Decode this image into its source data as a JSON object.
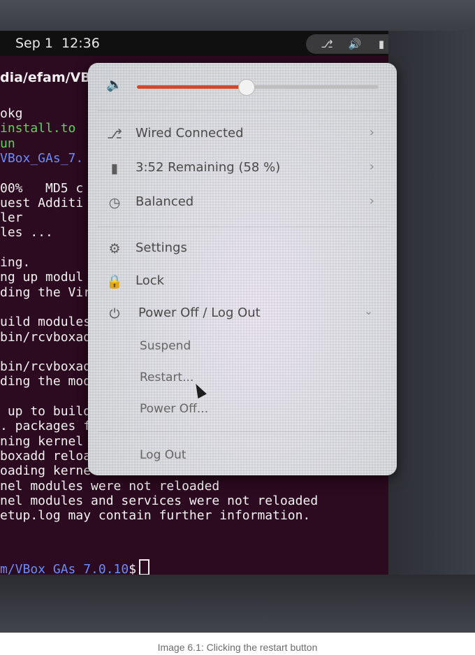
{
  "topbar": {
    "date": "Sep 1",
    "time": "12:36"
  },
  "tray": {
    "icons": [
      "network-wired-icon",
      "speaker-icon",
      "battery-icon"
    ]
  },
  "terminal": {
    "path_line": "dia/efam/VB",
    "lines": [
      {
        "text": "okg",
        "color": "white"
      },
      {
        "text": "install.to",
        "color": "green"
      },
      {
        "text": "un",
        "color": "green"
      },
      {
        "text": "VBox_GAs_7.",
        "color": "blue"
      },
      {
        "text": "",
        "color": "white"
      },
      {
        "text": "00%   MD5 c",
        "color": "white"
      },
      {
        "text": "uest Additi",
        "color": "white"
      },
      {
        "text": "ler",
        "color": "white"
      },
      {
        "text": "les ...",
        "color": "white"
      },
      {
        "text": "",
        "color": "white"
      },
      {
        "text": "ing.",
        "color": "white"
      },
      {
        "text": "ng up modul",
        "color": "white"
      },
      {
        "text": "ding the Vir",
        "color": "white"
      },
      {
        "text": "",
        "color": "white"
      },
      {
        "text": "uild modules",
        "color": "white"
      },
      {
        "text": "bin/rcvboxad",
        "color": "white"
      },
      {
        "text": "",
        "color": "white"
      },
      {
        "text": "bin/rcvboxad",
        "color": "white"
      },
      {
        "text": "ding the mod",
        "color": "white"
      },
      {
        "text": "",
        "color": "white"
      },
      {
        "text": " up to build",
        "color": "white"
      },
      {
        "text": ". packages fr",
        "color": "white"
      },
      {
        "text": "ning kernel modules will not be replaced until",
        "color": "white"
      },
      {
        "text": "boxadd reload' triggered",
        "color": "white"
      },
      {
        "text": "oading kernel modules and services",
        "color": "white"
      },
      {
        "text": "nel modules were not reloaded",
        "color": "white"
      },
      {
        "text": "nel modules and services were not reloaded",
        "color": "white"
      },
      {
        "text": "etup.log may contain further information.",
        "color": "white"
      }
    ],
    "prompt_path": "m/VBox_GAs_7.0.10",
    "prompt_symbol": "$"
  },
  "menu": {
    "volume_level": 0.45,
    "accent_color": "#d2482b",
    "wired": {
      "label": "Wired Connected",
      "icon": "network-wired-icon"
    },
    "battery": {
      "label": "3:52 Remaining (58 %)",
      "icon": "battery-icon"
    },
    "power_mode": {
      "label": "Balanced",
      "icon": "power-mode-icon"
    },
    "settings": {
      "label": "Settings",
      "icon": "gear-icon"
    },
    "lock": {
      "label": "Lock",
      "icon": "lock-icon"
    },
    "power_off_logout": {
      "label": "Power Off / Log Out",
      "icon": "power-icon"
    },
    "suspend": {
      "label": "Suspend"
    },
    "restart": {
      "label": "Restart..."
    },
    "power_off": {
      "label": "Power Off..."
    },
    "log_out": {
      "label": "Log Out"
    }
  },
  "caption": "Image 6.1: Clicking the restart button"
}
